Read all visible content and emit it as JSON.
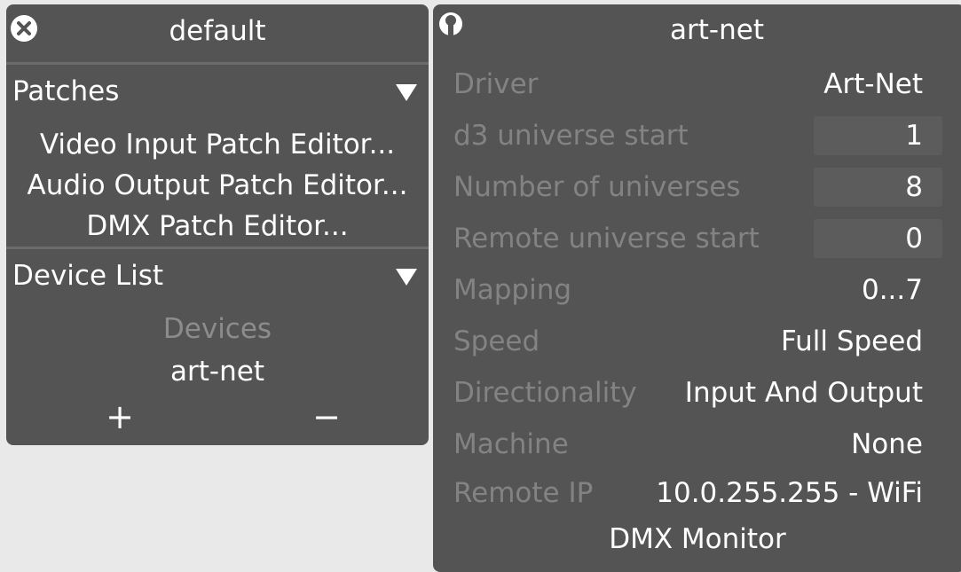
{
  "left_panel": {
    "title": "default",
    "close_icon": "close-icon",
    "patches": {
      "label": "Patches",
      "items": [
        "Video Input Patch Editor...",
        "Audio Output Patch Editor...",
        "DMX Patch Editor..."
      ]
    },
    "device_list": {
      "label": "Device List",
      "devices_heading": "Devices",
      "devices": [
        "art-net"
      ],
      "add_label": "+",
      "remove_label": "−"
    }
  },
  "right_panel": {
    "title": "art-net",
    "pin_icon": "pin-icon",
    "properties": [
      {
        "label": "Driver",
        "value": "Art-Net"
      },
      {
        "label": "d3 universe start",
        "value": "1"
      },
      {
        "label": "Number of universes",
        "value": "8"
      },
      {
        "label": "Remote universe start",
        "value": "0"
      },
      {
        "label": "Mapping",
        "value": "0...7"
      },
      {
        "label": "Speed",
        "value": "Full Speed"
      },
      {
        "label": "Directionality",
        "value": "Input And Output"
      },
      {
        "label": "Machine",
        "value": "None"
      },
      {
        "label": "Remote IP",
        "value": "10.0.255.255 - WiFi"
      }
    ],
    "dmx_monitor_label": "DMX Monitor"
  }
}
